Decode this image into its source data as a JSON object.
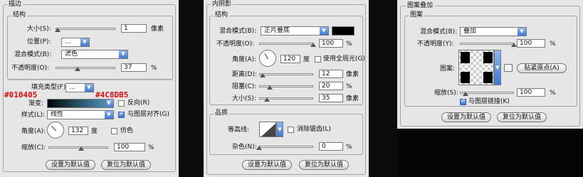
{
  "stroke": {
    "title": "描边",
    "structure_title": "结构",
    "size_label": "大小(S):",
    "size_value": "1",
    "size_unit": "像素",
    "size_level": 0.03,
    "position_label": "位置(P):",
    "position_value": "...",
    "blend_label": "混合模式(B):",
    "blend_value": "滤色",
    "opacity_label": "不透明度(O):",
    "opacity_value": "37",
    "opacity_unit": "%",
    "opacity_level": 0.37,
    "fill_type_label": "填充类型(F):",
    "fill_type_value": "...",
    "color_start": "#010405",
    "color_end": "#4C8DB5",
    "gradient_label": "渐变:",
    "reverse_label": "反向(R)",
    "style_label": "样式(L):",
    "style_value": "线性",
    "align_label": "与图层对齐(G)",
    "angle_label": "角度(A):",
    "angle_value": "132",
    "angle_unit": "度",
    "dither_label": "仿色",
    "scale_label": "缩放(C):",
    "scale_value": "100",
    "scale_unit": "%",
    "scale_level": 0.55,
    "default_button": "设置为默认值",
    "reset_button": "复位为默认值"
  },
  "inner_shadow": {
    "title": "内阴影",
    "structure_title": "结构",
    "blend_label": "混合模式(B):",
    "blend_value": "正片叠底",
    "swatch_color": "#000000",
    "opacity_label": "不透明度(O):",
    "opacity_value": "100",
    "opacity_unit": "%",
    "opacity_level": 1.0,
    "angle_label": "角度(A):",
    "angle_value": "120",
    "angle_unit": "度",
    "global_light_label": "使用全局光(G)",
    "distance_label": "距离(D):",
    "distance_value": "12",
    "distance_unit": "像素",
    "distance_level": 0.06,
    "choke_label": "阻塞(C):",
    "choke_value": "20",
    "choke_unit": "%",
    "choke_level": 0.2,
    "size_label": "大小(S):",
    "size_value": "35",
    "size_unit": "像素",
    "size_level": 0.14,
    "quality_title": "品质",
    "contour_label": "等高线:",
    "antialias_label": "消除锯齿(L)",
    "noise_label": "杂色(N):",
    "noise_value": "0",
    "noise_unit": "%",
    "noise_level": 0.0,
    "default_button": "设置为默认值",
    "reset_button": "复位为默认值"
  },
  "pattern_overlay": {
    "title": "图案叠加",
    "pattern_title": "图案",
    "blend_label": "混合模式(B):",
    "blend_value": "叠加",
    "opacity_label": "不透明度(Y):",
    "opacity_value": "100",
    "opacity_unit": "%",
    "opacity_level": 1.0,
    "pattern_label": "图案:",
    "snap_button": "贴紧原点(A)",
    "scale_label": "缩放(S):",
    "scale_value": "100",
    "scale_unit": "%",
    "scale_level": 0.1,
    "link_label": "与图层链接(K)",
    "default_button": "设置为默认值",
    "reset_button": "复位为默认值"
  }
}
